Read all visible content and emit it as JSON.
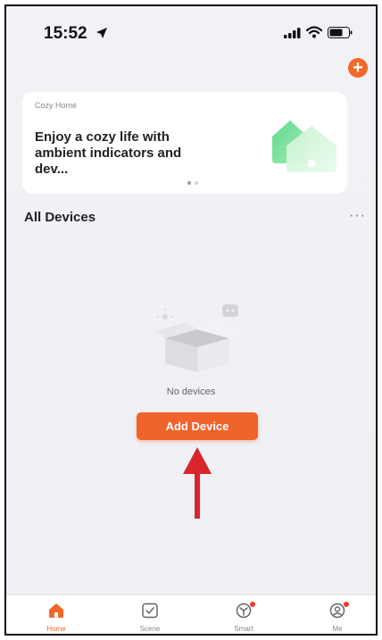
{
  "status_bar": {
    "time": "15:52"
  },
  "banner": {
    "title": "Cozy Home",
    "text": "Enjoy a cozy life with ambient indicators and dev..."
  },
  "devices": {
    "section_title": "All Devices",
    "more_label": "···",
    "empty_text": "No devices",
    "add_button_label": "Add Device"
  },
  "tabbar": {
    "items": [
      {
        "label": "Home",
        "icon": "home-icon",
        "active": true
      },
      {
        "label": "Scene",
        "icon": "scene-icon",
        "active": false
      },
      {
        "label": "Smart",
        "icon": "smart-icon",
        "active": false,
        "badge": true
      },
      {
        "label": "Me",
        "icon": "profile-icon",
        "active": false,
        "badge": true
      }
    ]
  },
  "colors": {
    "accent": "#f2682a",
    "badge": "#f23b2b",
    "annotation_arrow": "#d9262d"
  }
}
